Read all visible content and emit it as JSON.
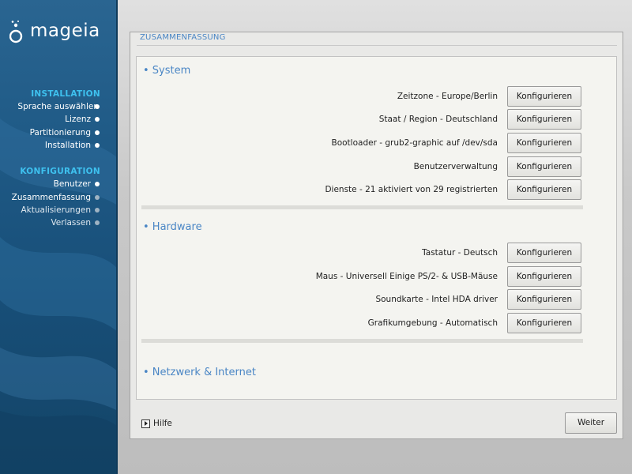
{
  "sidebar": {
    "logo_text": "mageia",
    "installation_heading": "INSTALLATION",
    "installation_steps": [
      {
        "label": "Sprache auswählen",
        "state": "done"
      },
      {
        "label": "Lizenz",
        "state": "done"
      },
      {
        "label": "Partitionierung",
        "state": "done"
      },
      {
        "label": "Installation",
        "state": "done"
      }
    ],
    "configuration_heading": "KONFIGURATION",
    "configuration_steps": [
      {
        "label": "Benutzer",
        "state": "done"
      },
      {
        "label": "Zusammenfassung",
        "state": "current"
      },
      {
        "label": "Aktualisierungen",
        "state": "pending"
      },
      {
        "label": "Verlassen",
        "state": "pending"
      }
    ]
  },
  "panel": {
    "title": "ZUSAMMENFASSUNG",
    "sections": [
      {
        "title": "• System",
        "rows": [
          {
            "label": "Zeitzone - Europe/Berlin",
            "button": "Konfigurieren"
          },
          {
            "label": "Staat / Region - Deutschland",
            "button": "Konfigurieren"
          },
          {
            "label": "Bootloader - grub2-graphic auf /dev/sda",
            "button": "Konfigurieren"
          },
          {
            "label": "Benutzerverwaltung",
            "button": "Konfigurieren"
          },
          {
            "label": "Dienste - 21 aktiviert von 29 registrierten",
            "button": "Konfigurieren"
          }
        ]
      },
      {
        "title": "• Hardware",
        "rows": [
          {
            "label": "Tastatur - Deutsch",
            "button": "Konfigurieren"
          },
          {
            "label": "Maus - Universell Einige PS/2- & USB-Mäuse",
            "button": "Konfigurieren"
          },
          {
            "label": "Soundkarte - Intel HDA driver",
            "button": "Konfigurieren"
          },
          {
            "label": "Grafikumgebung - Automatisch",
            "button": "Konfigurieren"
          }
        ]
      },
      {
        "title": "• Netzwerk & Internet",
        "rows": []
      }
    ],
    "help_label": "Hilfe",
    "next_label": "Weiter"
  },
  "colors": {
    "accent": "#4a86c5",
    "sidebar_heading": "#3ec1ef",
    "sidebar_bg": "#1f5a86"
  }
}
